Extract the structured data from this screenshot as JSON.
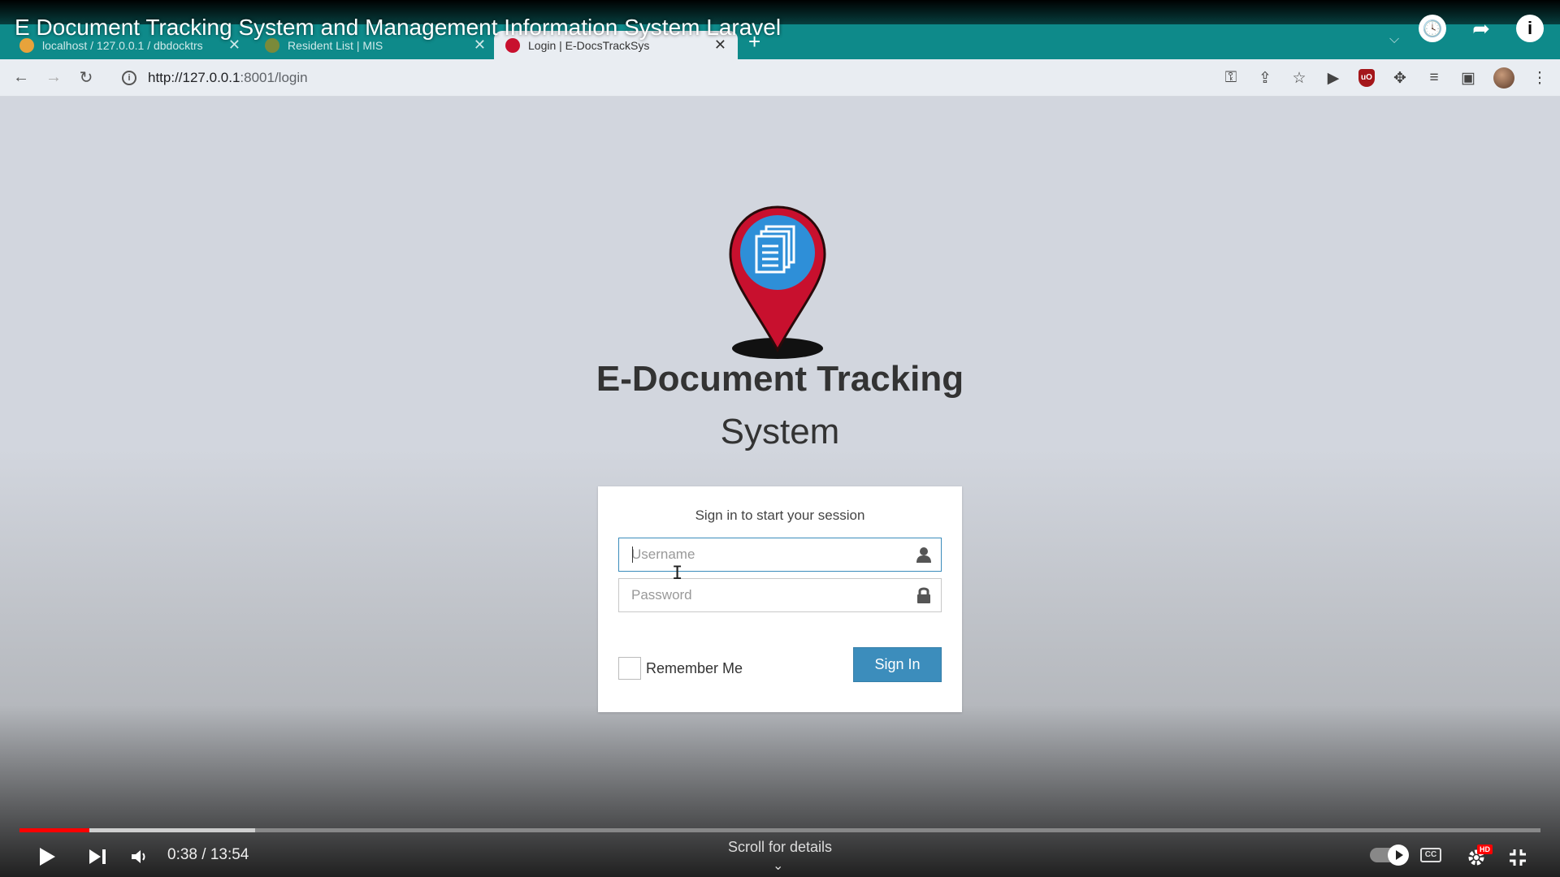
{
  "video": {
    "title": "E Document Tracking System and Management Information System Laravel",
    "time_current": "0:38",
    "time_total": "13:54",
    "time_display": "0:38 / 13:54",
    "progress_fraction": 0.046,
    "buffered_fraction": 0.155,
    "scroll_hint": "Scroll for details",
    "hd_badge": "HD",
    "cc_label": "CC"
  },
  "browser": {
    "tabs": [
      {
        "title": "localhost / 127.0.0.1 / dbdocktrs",
        "active": false
      },
      {
        "title": "Resident List | MIS",
        "active": false
      },
      {
        "title": "Login | E-DocsTrackSys",
        "active": true
      }
    ],
    "url_host": "http://127.0.0.1",
    "url_rest": ":8001/login"
  },
  "page": {
    "brand_line1": "E-Document Tracking",
    "brand_line2": "System",
    "login_message": "Sign in to start your session",
    "username_placeholder": "Username",
    "password_placeholder": "Password",
    "remember_label": "Remember Me",
    "signin_label": "Sign In"
  },
  "colors": {
    "tabstrip": "#0e8a8a",
    "page_bg": "#d2d6de",
    "primary_button": "#3c8dbc",
    "pin_red": "#c8102e",
    "pin_blue": "#2e8fd8",
    "progress_red": "#ff0000"
  }
}
